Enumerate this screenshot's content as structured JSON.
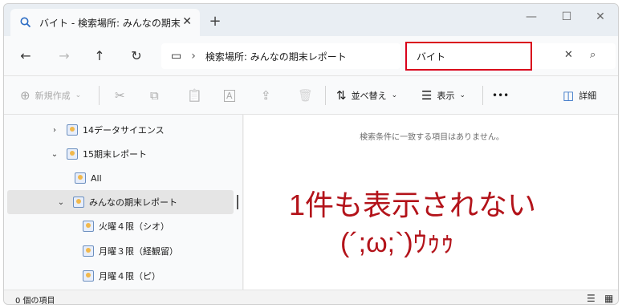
{
  "window": {
    "tab_title": "バイト - 検索場所: みんなの期末レ",
    "close_glyph": "✕",
    "new_tab_glyph": "+",
    "minimize_glyph": "—",
    "maximize_glyph": "☐",
    "window_close_glyph": "✕"
  },
  "nav": {
    "back": "←",
    "forward": "→",
    "up": "↑",
    "refresh": "↻"
  },
  "address": {
    "pc_icon": "▭",
    "separator": "›",
    "location": "検索場所: みんなの期末レポート"
  },
  "search": {
    "value": "バイト",
    "clear": "✕",
    "go": "⌕",
    "highlight_color": "#d9001b"
  },
  "toolbar": {
    "new_label": "新規作成",
    "new_icon": "⊕",
    "chevron": "⌄",
    "cut_icon": "✂",
    "copy_icon": "⧉",
    "paste_icon": "📋",
    "rename_icon": "A",
    "share_icon": "⇪",
    "delete_icon": "🗑",
    "sort_label": "並べ替え",
    "sort_icon": "⇅",
    "view_label": "表示",
    "view_icon": "☰",
    "more": "•••",
    "details_label": "詳細",
    "details_icon": "◫"
  },
  "tree": [
    {
      "label": "14データサイエンス",
      "chevron": "›"
    },
    {
      "label": "15期末レポート",
      "chevron": "⌄"
    },
    {
      "label": "All",
      "chevron": ""
    },
    {
      "label": "みんなの期末レポート",
      "chevron": "⌄"
    },
    {
      "label": "火曜４限（シオ）",
      "chevron": ""
    },
    {
      "label": "月曜３限（経観留）",
      "chevron": ""
    },
    {
      "label": "月曜４限（ピ）",
      "chevron": ""
    }
  ],
  "content": {
    "empty_message": "検索条件に一致する項目はありません。",
    "overlay_line1": "1件も表示されない",
    "overlay_line2": "(´;ω;`)ｳｩｩ",
    "overlay_color": "#b3131a"
  },
  "status": {
    "count": "0 個の項目",
    "details_view": "☰",
    "tiles_view": "▦"
  }
}
